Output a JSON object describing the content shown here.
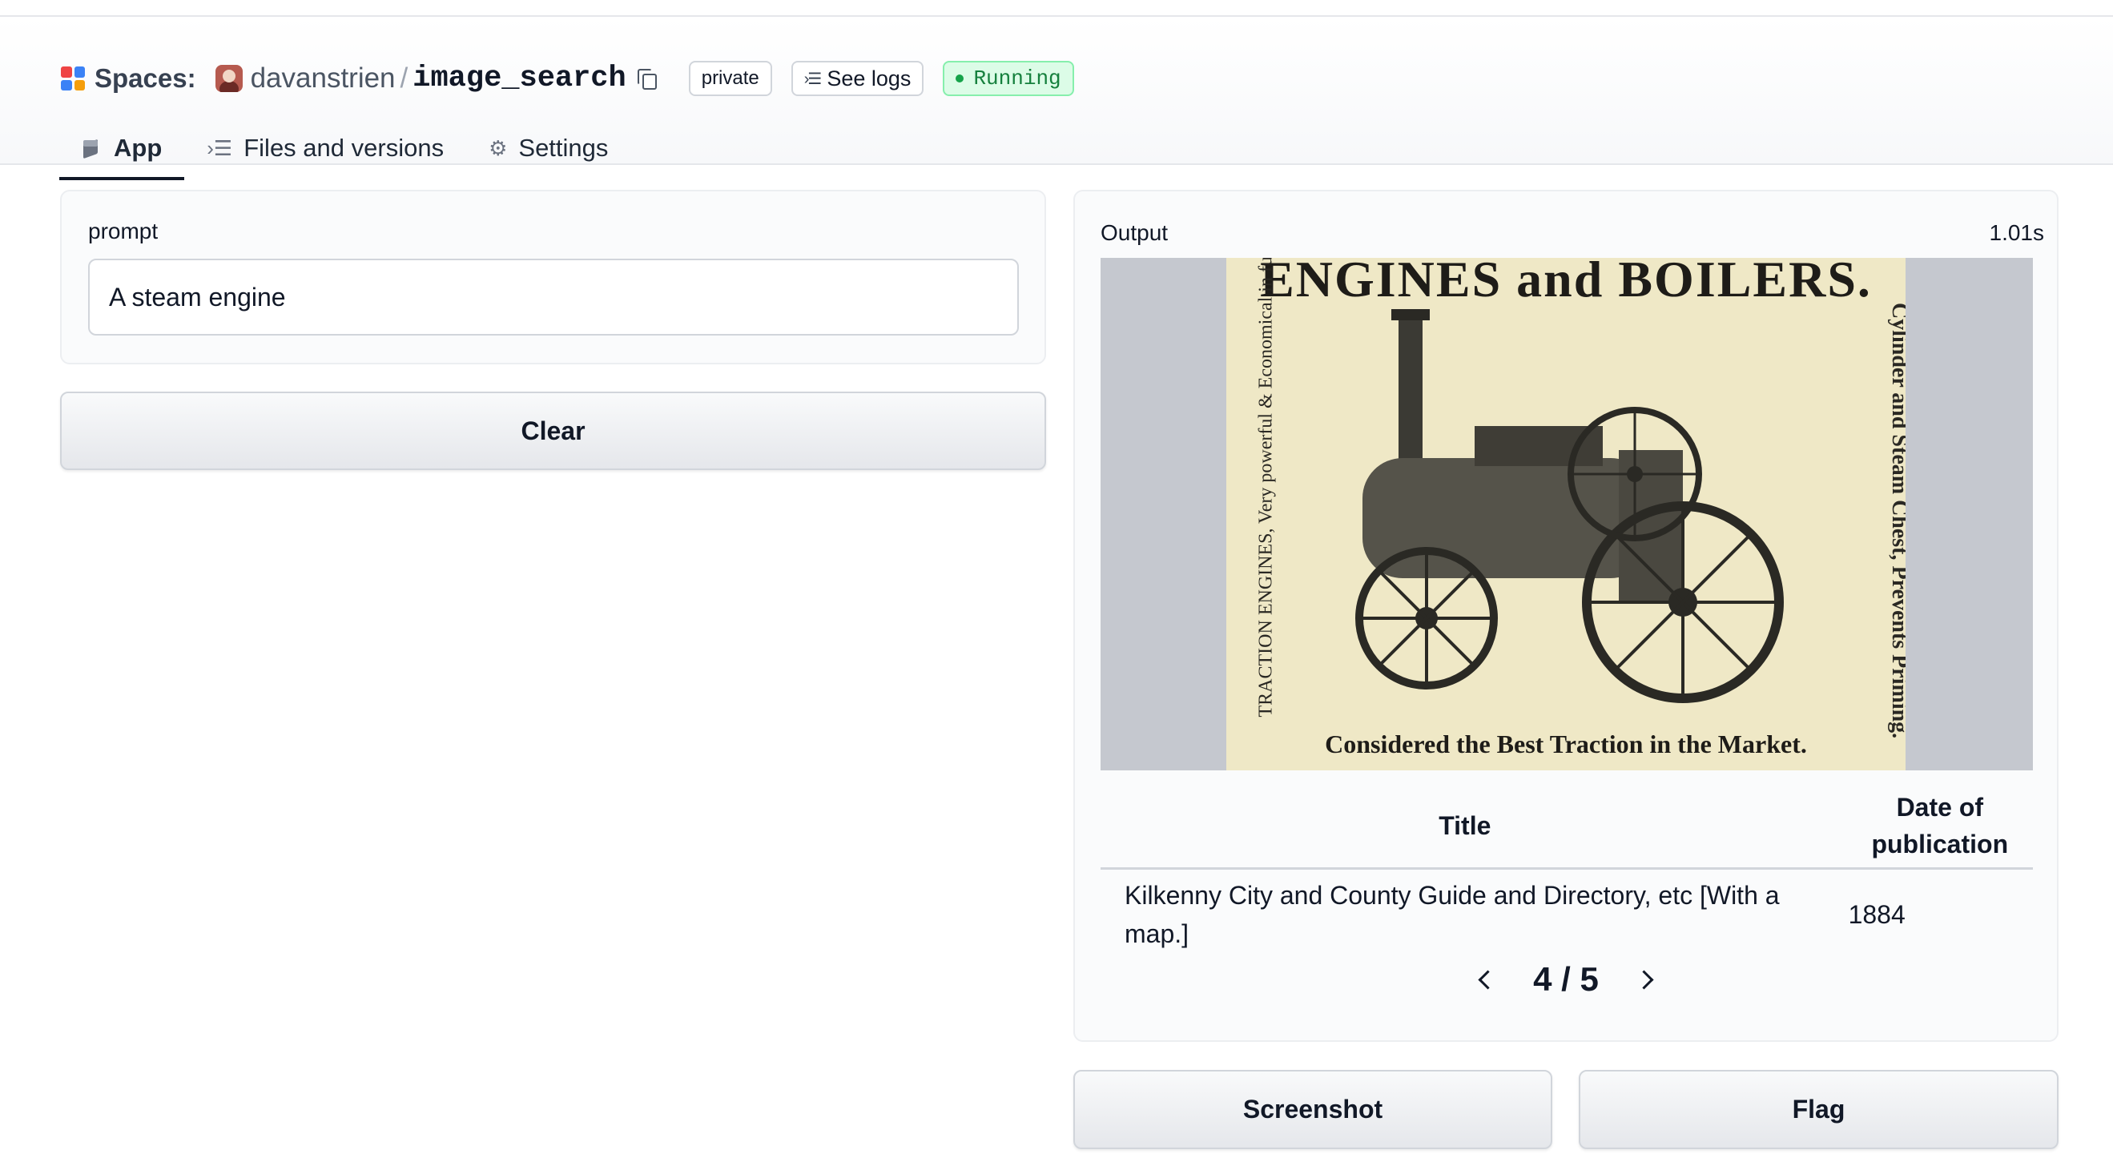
{
  "header": {
    "spaces_label": "Spaces:",
    "owner": "davanstrien",
    "separator": "/",
    "repo": "image_search",
    "visibility": "private",
    "logs_label": "See logs",
    "status": "Running",
    "status_color": "#16a34a"
  },
  "tabs": [
    {
      "label": "App",
      "icon": "cube-icon",
      "active": true
    },
    {
      "label": "Files and versions",
      "icon": "files-icon",
      "active": false
    },
    {
      "label": "Settings",
      "icon": "gear-icon",
      "active": false
    }
  ],
  "input": {
    "label": "prompt",
    "value": "A steam engine",
    "clear_label": "Clear"
  },
  "output": {
    "label": "Output",
    "time": "1.01s",
    "image_text": {
      "top": "ENGINES and BOILERS.",
      "bottom": "Considered the Best Traction in the Market.",
      "left": "TRACTION ENGINES, Very powerful & Economical in fuel and water.",
      "right": "Cylinder and Steam Chest, Prevents Priming."
    },
    "table": {
      "headers": [
        "Title",
        "Date of publication"
      ],
      "rows": [
        {
          "title": "Kilkenny City and County Guide and Directory, etc [With a map.]",
          "date": "1884"
        }
      ]
    },
    "pager": "4 / 5"
  },
  "actions": {
    "screenshot_label": "Screenshot",
    "flag_label": "Flag"
  }
}
